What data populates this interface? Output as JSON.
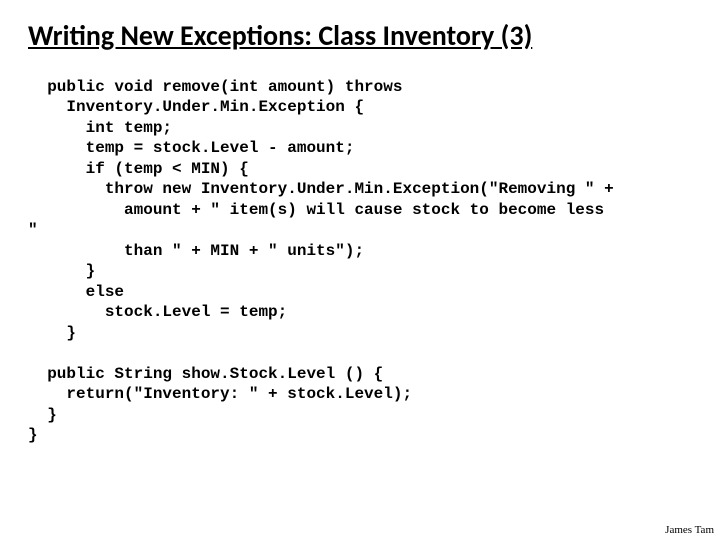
{
  "title": "Writing New Exceptions: Class Inventory (3)",
  "code": "  public void remove(int amount) throws\n    Inventory.Under.Min.Exception {\n      int temp;\n      temp = stock.Level - amount;\n      if (temp < MIN) {\n        throw new Inventory.Under.Min.Exception(\"Removing \" +\n          amount + \" item(s) will cause stock to become less\n\"\n          than \" + MIN + \" units\");\n      }\n      else\n        stock.Level = temp;\n    }\n\n  public String show.Stock.Level () {\n    return(\"Inventory: \" + stock.Level);\n  }\n}",
  "footer": "James Tam"
}
